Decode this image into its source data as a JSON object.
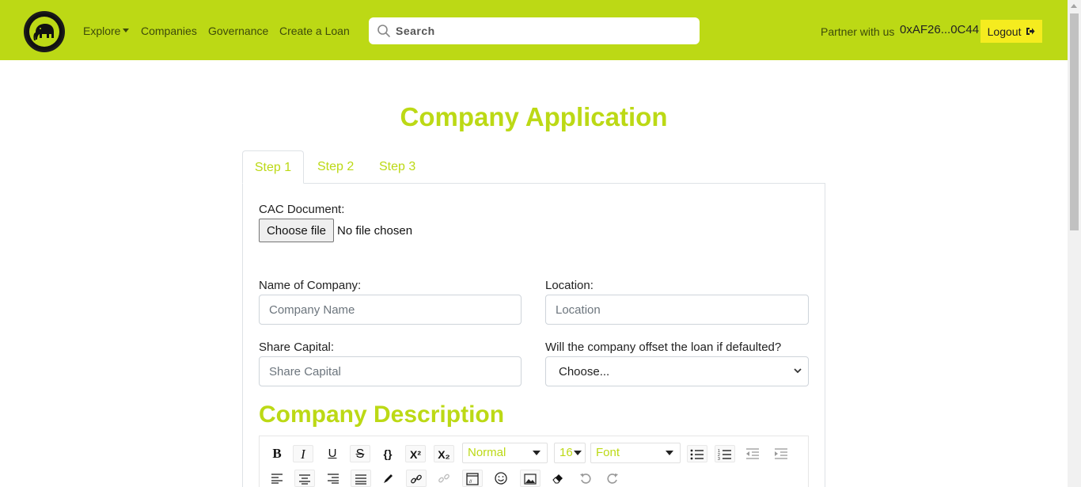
{
  "navbar": {
    "explore": "Explore",
    "companies": "Companies",
    "governance": "Governance",
    "create_loan": "Create a Loan",
    "search_placeholder": "Search",
    "partner": "Partner with us",
    "address": "0xAF26...0C44",
    "logout": "Logout"
  },
  "page": {
    "title": "Company Application",
    "tabs": [
      "Step 1",
      "Step 2",
      "Step 3"
    ],
    "active_tab": "Step 1"
  },
  "form": {
    "cac_label": "CAC Document:",
    "file_button": "Choose file",
    "file_status": "No file chosen",
    "name_label": "Name of Company:",
    "name_placeholder": "Company Name",
    "location_label": "Location:",
    "location_placeholder": "Location",
    "capital_label": "Share Capital:",
    "capital_placeholder": "Share Capital",
    "offset_label": "Will the company offset the loan if defaulted?",
    "offset_value": "Choose..."
  },
  "editor": {
    "section_title": "Company Description",
    "heading_select": "Normal",
    "size_select": "16",
    "font_select": "Font",
    "icons": [
      "bold-icon",
      "italic-icon",
      "underline-icon",
      "strikethrough-icon",
      "code-icon",
      "superscript-icon",
      "subscript-icon",
      "bullet-list-icon",
      "numbered-list-icon",
      "outdent-icon",
      "indent-icon",
      "align-left-icon",
      "align-center-icon",
      "align-right-icon",
      "align-justify-icon",
      "pen-icon",
      "link-icon",
      "unlink-icon",
      "embed-icon",
      "emoji-icon",
      "image-icon",
      "eraser-icon",
      "undo-icon",
      "redo-icon"
    ]
  },
  "colors": {
    "brand": "#bcd915",
    "logout_bg": "#f5ec1f"
  }
}
